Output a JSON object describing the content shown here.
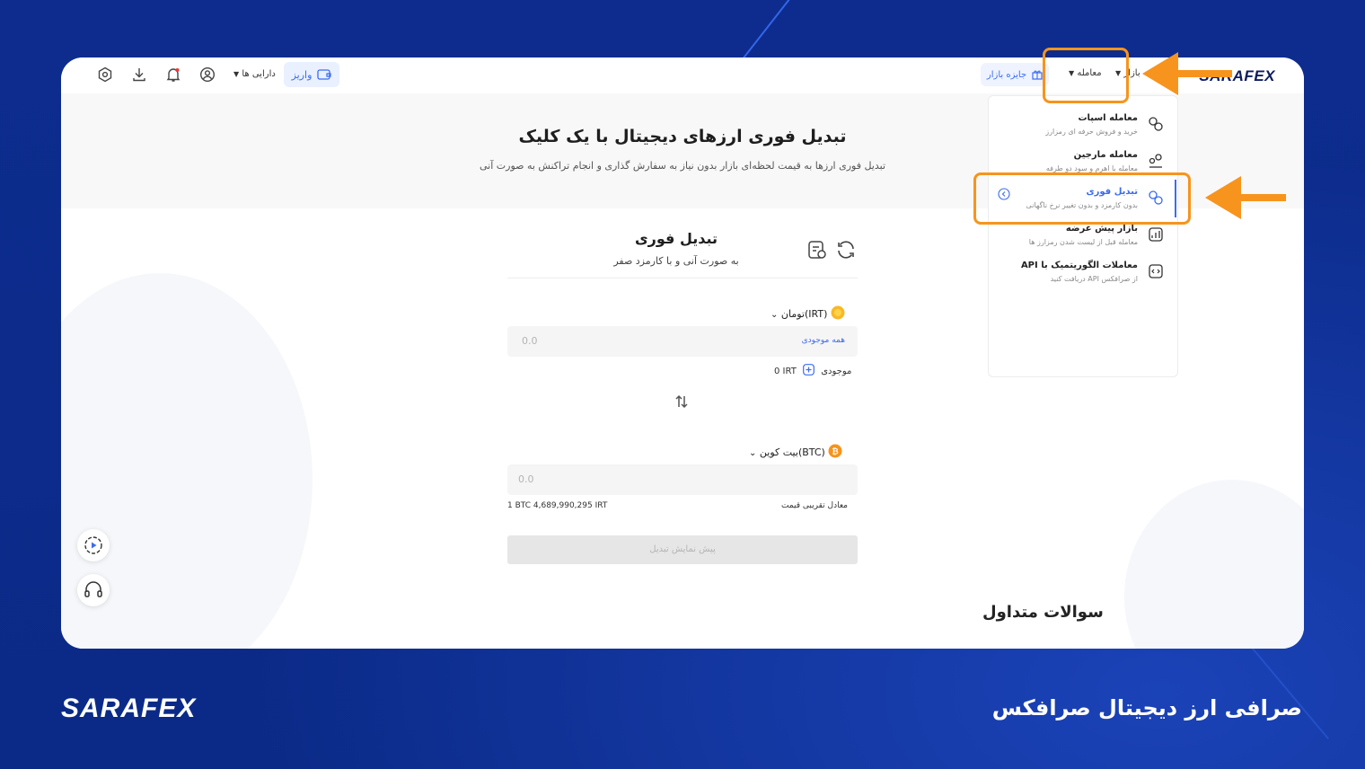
{
  "header": {
    "logo": "SARAFEX",
    "market_label": "بازار",
    "trade_label": "معامله",
    "prize_label": "جایزه بازار",
    "deposit_label": "واریز",
    "assets_label": "دارایی ها"
  },
  "hero": {
    "title": "تبدیل فوری ارزهای دیجیتال با یک کلیک",
    "subtitle": "تبدیل فوری ارزها به قیمت لحظه‌ای بازار بدون نیاز به سفارش گذاری و انجام تراکنش به صورت آنی"
  },
  "menu": {
    "items": [
      {
        "title": "معامله اسپات",
        "subtitle": "خرید و فروش حرفه ای رمزارز",
        "icon": "spot-icon"
      },
      {
        "title": "معامله مارجین",
        "subtitle": "معامله با اهرم و سود دو طرفه",
        "icon": "margin-icon"
      },
      {
        "title": "تبدیل فوری",
        "subtitle": "بدون کارمزد و بدون تغییر نرخ ناگهانی",
        "icon": "convert-icon"
      },
      {
        "title": "بازار پیش عرضه",
        "subtitle": "معامله قبل از لیست شدن رمزارز ها",
        "icon": "chart-icon"
      },
      {
        "title": "معاملات الگوریتمیک با API",
        "subtitle": "از صرافکس API دریافت کنید",
        "icon": "api-icon"
      }
    ]
  },
  "convert": {
    "title": "تبدیل فوری",
    "subtitle": "به صورت آنی و با کارمزد صفر",
    "from_currency": "تومان(IRT)",
    "from_placeholder": "0.0",
    "all_balance": "همه موجودی",
    "balance_label": "موجودی",
    "balance_value": "0 IRT",
    "to_currency": "بیت کوین(BTC)",
    "to_placeholder": "0.0",
    "rate_label": "معادل تقریبی قیمت",
    "rate_value": "1 BTC   4,689,990,295 IRT",
    "submit_label": "پیش نمایش تبدیل",
    "faq_title": "سوالات متداول"
  },
  "footer": {
    "logo": "SARAFEX",
    "caption": "صرافی ارز دیجیتال صرافکس"
  },
  "colors": {
    "background": "#0c2a8a",
    "accent": "#3b6cf0",
    "highlight": "#f7941d"
  }
}
